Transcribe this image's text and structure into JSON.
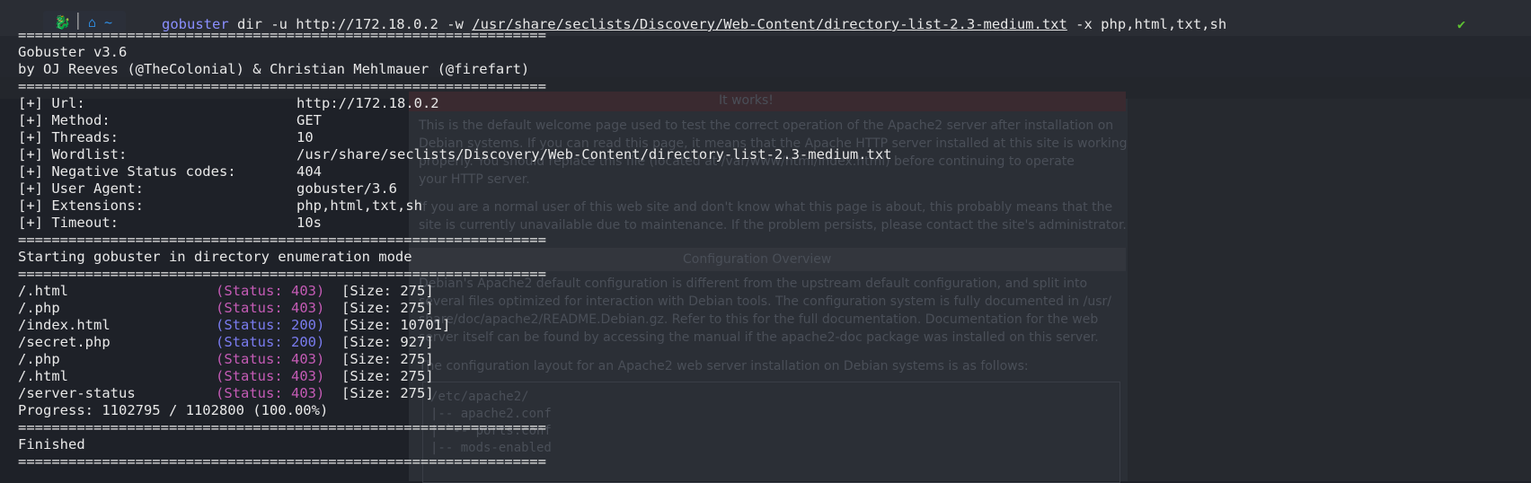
{
  "command": {
    "tool": "gobuster",
    "args_before_path": " dir -u http://172.18.0.2 -w ",
    "wordlist_path": "/usr/share/seclists/Discovery/Web-Content/directory-list-2.3-medium.txt",
    "args_after_path": " -x php,html,txt,sh"
  },
  "prompt": {
    "home": "~"
  },
  "divider": "===============================================================",
  "header": {
    "version": "Gobuster v3.6",
    "authors": "by OJ Reeves (@TheColonial) & Christian Mehlmauer (@firefart)"
  },
  "config": [
    {
      "label": "[+] Url:",
      "value": "http://172.18.0.2"
    },
    {
      "label": "[+] Method:",
      "value": "GET"
    },
    {
      "label": "[+] Threads:",
      "value": "10"
    },
    {
      "label": "[+] Wordlist:",
      "value": "/usr/share/seclists/Discovery/Web-Content/directory-list-2.3-medium.txt"
    },
    {
      "label": "[+] Negative Status codes:",
      "value": "404"
    },
    {
      "label": "[+] User Agent:",
      "value": "gobuster/3.6"
    },
    {
      "label": "[+] Extensions:",
      "value": "php,html,txt,sh"
    },
    {
      "label": "[+] Timeout:",
      "value": "10s"
    }
  ],
  "mode_line": "Starting gobuster in directory enumeration mode",
  "results": [
    {
      "path": "/.html",
      "status": "(Status: 403)",
      "size": "[Size: 275]"
    },
    {
      "path": "/.php",
      "status": "(Status: 403)",
      "size": "[Size: 275]"
    },
    {
      "path": "/index.html",
      "status": "(Status: 200)",
      "size": "[Size: 10701]"
    },
    {
      "path": "/secret.php",
      "status": "(Status: 200)",
      "size": "[Size: 927]"
    },
    {
      "path": "/.php",
      "status": "(Status: 403)",
      "size": "[Size: 275]"
    },
    {
      "path": "/.html",
      "status": "(Status: 403)",
      "size": "[Size: 275]"
    },
    {
      "path": "/server-status",
      "status": "(Status: 403)",
      "size": "[Size: 275]"
    }
  ],
  "progress": "Progress: 1102795 / 1102800 (100.00%)",
  "finished": "Finished",
  "background": {
    "banner": "It works!",
    "para1_l1": "This is the default welcome page used to test the correct operation of the Apache2 server after installation on",
    "para1_l2": "Debian systems. If you can read this page, it means that the Apache HTTP server installed at this site is working",
    "para1_l3": "properly. You should replace this file (located at /var/www/html/index.html) before continuing to operate",
    "para1_l4": "your HTTP server.",
    "para2_l1": "If you are a normal user of this web site and don't know what this page is about, this probably means that the",
    "para2_l2": "site is currently unavailable due to maintenance. If the problem persists, please contact the site's administrator.",
    "heading": "Configuration Overview",
    "para3_l1": "Debian's Apache2 default configuration is different from the upstream default configuration, and split into",
    "para3_l2": "several files optimized for interaction with Debian tools. The configuration system is fully documented in /usr/",
    "para3_l3": "share/doc/apache2/README.Debian.gz. Refer to this for the full documentation. Documentation for the web",
    "para3_l4": "server itself can be found by accessing the manual if the apache2-doc package was installed on this server.",
    "para4": "The configuration layout for an Apache2 web server installation on Debian systems is as follows:",
    "code_l1": "/etc/apache2/",
    "code_l2": "|-- apache2.conf",
    "code_l3": "|       `-- ports.conf",
    "code_l4": "|-- mods-enabled"
  }
}
